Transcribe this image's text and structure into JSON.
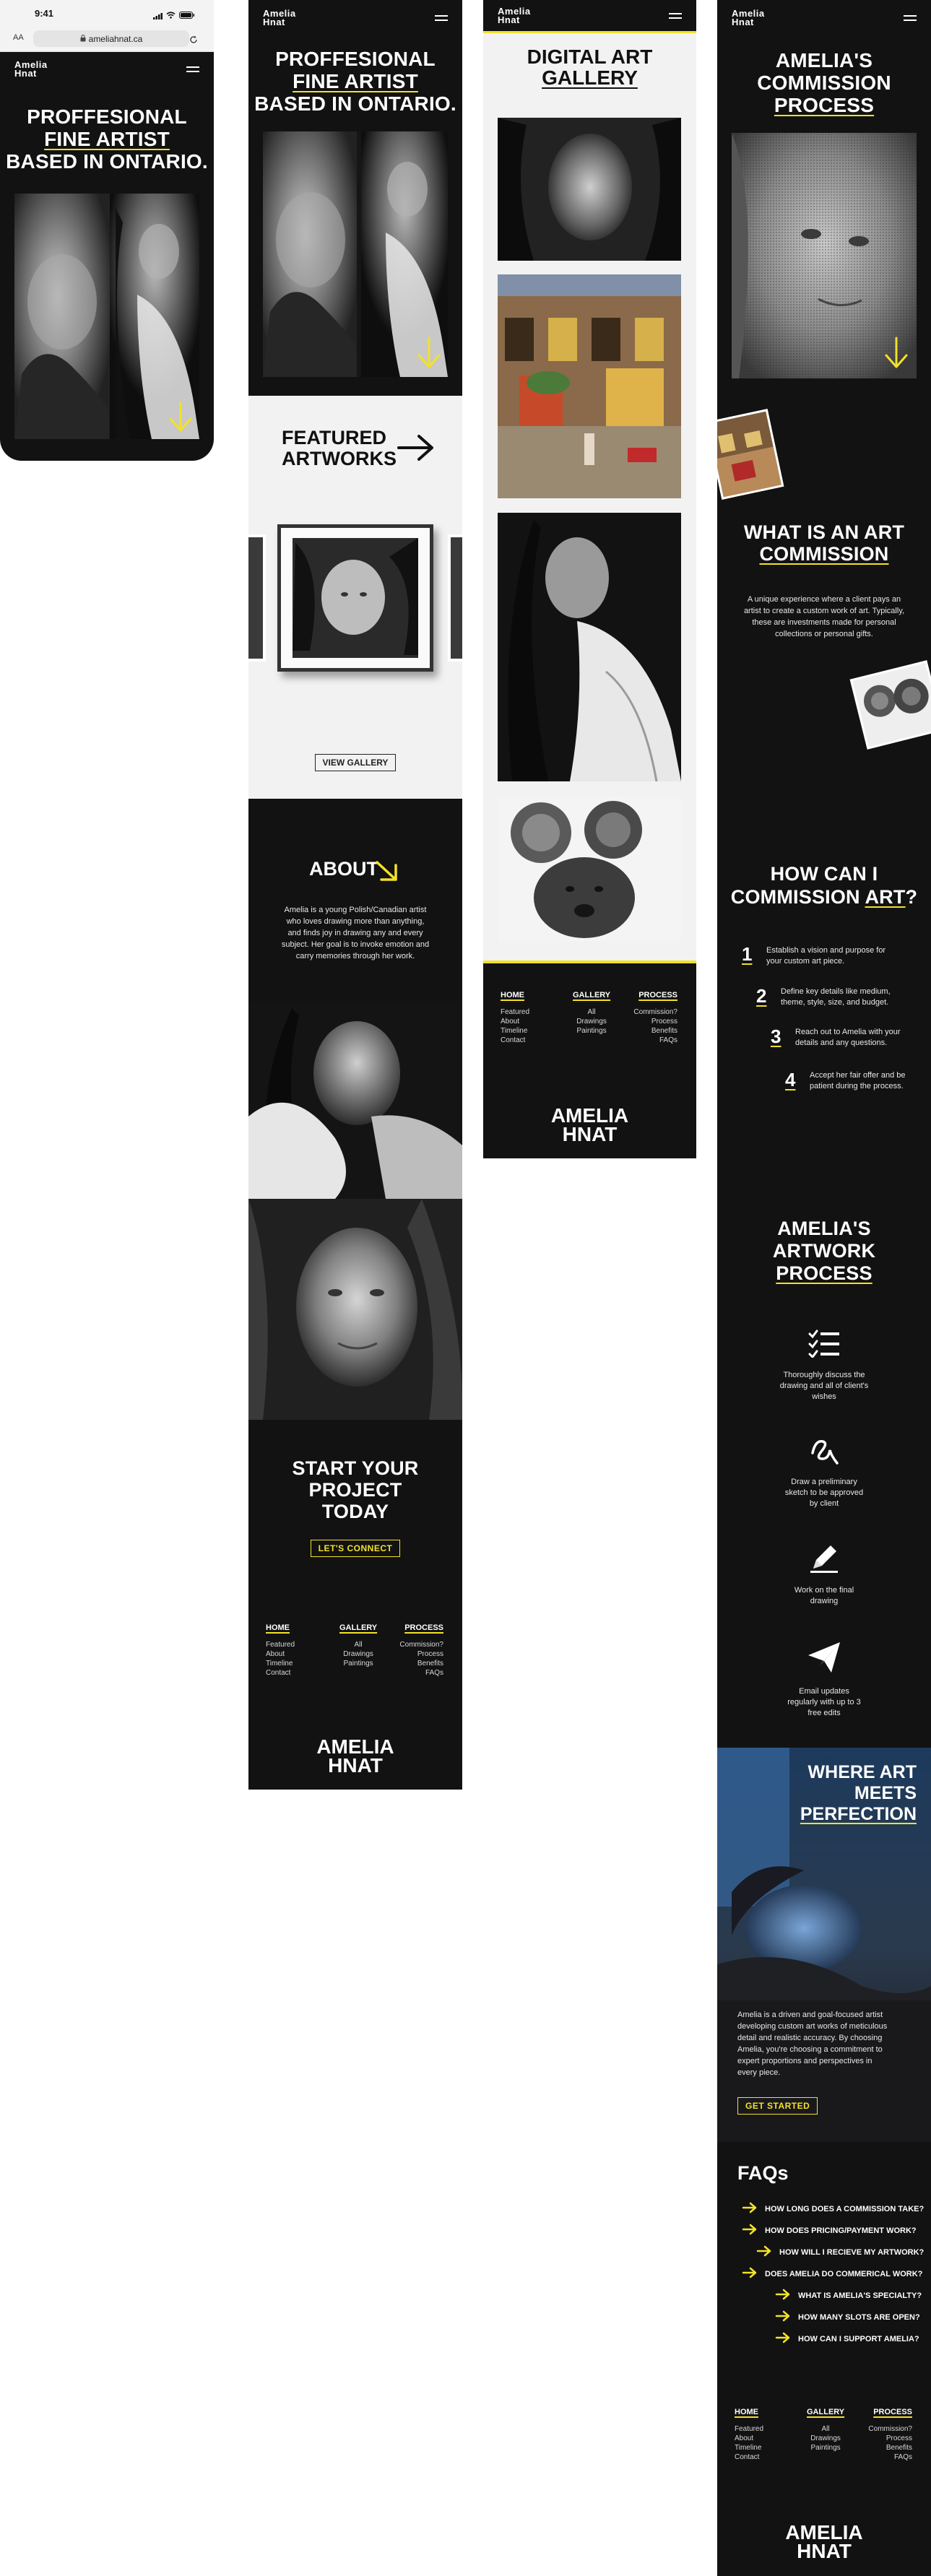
{
  "phone": {
    "status": {
      "time": "9:41"
    },
    "browser": {
      "aa": "AA",
      "url": "ameliahnat.ca"
    },
    "logo": "Amelia\nHnat",
    "hero": {
      "line1": "PROFFESIONAL",
      "line2": "FINE ARTIST",
      "line3": "BASED IN ONTARIO."
    }
  },
  "home": {
    "logo": "Amelia\nHnat",
    "hero": {
      "line1": "PROFFESIONAL",
      "line2": "FINE ARTIST",
      "line3": "BASED IN ONTARIO."
    },
    "featured": {
      "title_line1": "FEATURED",
      "title_line2": "ARTWORKS",
      "button": "VIEW GALLERY"
    },
    "about": {
      "title": "ABOUT",
      "text": "Amelia is a young Polish/Canadian artist who loves drawing more than anything, and finds joy in drawing any and every subject. Her goal is to invoke emotion and carry memories through her work."
    },
    "cta": {
      "line1": "START YOUR",
      "line2": "PROJECT",
      "line3": "TODAY",
      "button": "LET'S CONNECT"
    }
  },
  "gallery": {
    "logo": "Amelia\nHnat",
    "title_line1": "DIGITAL ART",
    "title_line2": "GALLERY"
  },
  "process": {
    "logo": "Amelia\nHnat",
    "hero": {
      "line1": "AMELIA'S",
      "line2": "COMMISSION",
      "line3": "PROCESS"
    },
    "what": {
      "line1": "WHAT IS AN ART",
      "line2": "COMMISSION",
      "text": "A unique experience where a client pays an artist to create a custom work of art. Typically, these are investments made for personal collections or personal gifts."
    },
    "how": {
      "line1": "HOW CAN I",
      "line2a": "COMMISSION ",
      "line2b": "ART",
      "line2c": "?",
      "steps": [
        {
          "n": "1",
          "text": "Establish a vision and purpose for your custom art piece."
        },
        {
          "n": "2",
          "text": "Define key details like medium, theme, style, size, and budget."
        },
        {
          "n": "3",
          "text": "Reach out to Amelia with your details and any questions."
        },
        {
          "n": "4",
          "text": "Accept her fair offer and be patient during the process."
        }
      ]
    },
    "artwork": {
      "line1": "AMELIA'S",
      "line2": "ARTWORK",
      "line3": "PROCESS",
      "items": [
        {
          "icon": "checklist-icon",
          "text": "Thoroughly discuss the drawing and all of client's wishes"
        },
        {
          "icon": "squiggle-icon",
          "text": "Draw a preliminary sketch to be approved by client"
        },
        {
          "icon": "pencil-icon",
          "text": "Work on the final drawing"
        },
        {
          "icon": "paper-plane-icon",
          "text": "Email updates regularly with up to 3 free edits"
        }
      ]
    },
    "where": {
      "line1": "WHERE ART",
      "line2": "MEETS",
      "line3": "PERFECTION",
      "text": "Amelia is a driven and goal-focused artist developing custom art works of meticulous detail and realistic accuracy. By choosing Amelia, you're choosing a commitment to expert proportions and perspectives in every piece.",
      "button": "GET STARTED"
    },
    "faqs": {
      "title": "FAQs",
      "items": [
        "HOW LONG DOES A COMMISSION TAKE?",
        "HOW DOES PRICING/PAYMENT WORK?",
        "HOW WILL I RECIEVE MY ARTWORK?",
        "DOES AMELIA DO COMMERICAL WORK?",
        "WHAT IS AMELIA'S SPECIALTY?",
        "HOW MANY SLOTS ARE OPEN?",
        "HOW CAN I SUPPORT AMELIA?"
      ]
    }
  },
  "footer": {
    "home": {
      "head": "HOME",
      "links": [
        "Featured",
        "About",
        "Timeline",
        "Contact"
      ]
    },
    "gallery": {
      "head": "GALLERY",
      "links": [
        "All",
        "Drawings",
        "Paintings"
      ]
    },
    "process": {
      "head": "PROCESS",
      "links": [
        "Commission?",
        "Process",
        "Benefits",
        "FAQs"
      ]
    },
    "brand": "AMELIA\nHNAT"
  },
  "colors": {
    "accent": "#f3e12a",
    "dark": "#121212",
    "light": "#f2f2f2"
  }
}
